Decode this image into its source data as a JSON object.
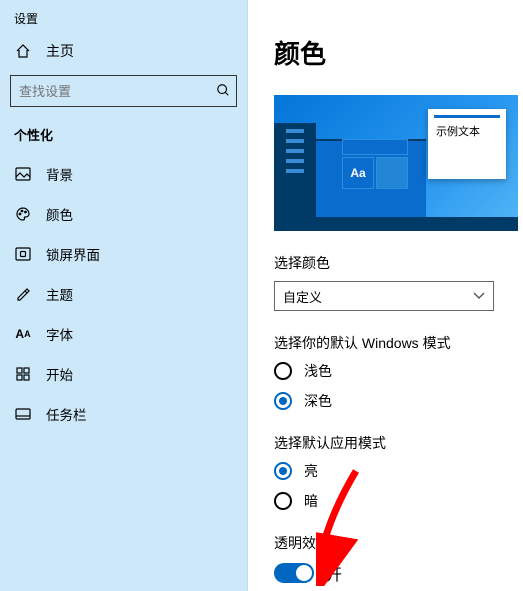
{
  "app_title": "设置",
  "home_label": "主页",
  "search": {
    "placeholder": "查找设置"
  },
  "category_label": "个性化",
  "sidebar": {
    "items": [
      {
        "label": "背景"
      },
      {
        "label": "颜色"
      },
      {
        "label": "锁屏界面"
      },
      {
        "label": "主题"
      },
      {
        "label": "字体"
      },
      {
        "label": "开始"
      },
      {
        "label": "任务栏"
      }
    ]
  },
  "page": {
    "title": "颜色",
    "sample_text": "示例文本",
    "accent_tile_label": "Aa",
    "choose_color_label": "选择颜色",
    "choose_color_value": "自定义",
    "windows_mode_label": "选择你的默认 Windows 模式",
    "windows_mode_options": {
      "light": "浅色",
      "dark": "深色"
    },
    "app_mode_label": "选择默认应用模式",
    "app_mode_options": {
      "light": "亮",
      "dark": "暗"
    },
    "transparency_label": "透明效果",
    "transparency_state": "开",
    "annotation": "red arrow pointing to transparency toggle"
  },
  "colors": {
    "accent": "#0067c0",
    "sidebar_bg": "#cde8f9"
  }
}
